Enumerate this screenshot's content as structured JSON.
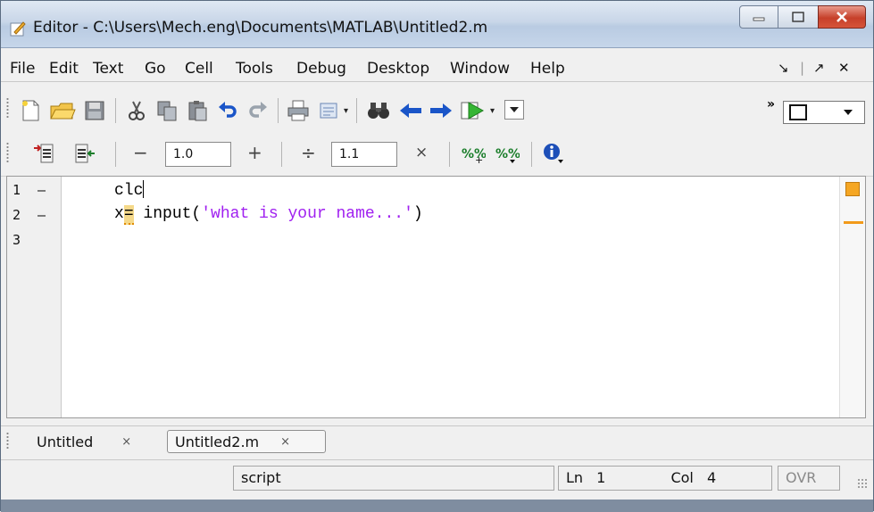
{
  "window": {
    "title": "Editor - C:\\Users\\Mech.eng\\Documents\\MATLAB\\Untitled2.m"
  },
  "menu": {
    "items": [
      "File",
      "Edit",
      "Text",
      "Go",
      "Cell",
      "Tools",
      "Debug",
      "Desktop",
      "Window",
      "Help"
    ],
    "undock_glyph": "↘",
    "maximize_glyph": "↗",
    "close_glyph": "✕"
  },
  "cell_toolbar": {
    "decrement_label": "−",
    "value1": "1.0",
    "increment_label": "+",
    "divide_label": "÷",
    "value2": "1.1",
    "multiply_label": "×"
  },
  "editor": {
    "lines": [
      {
        "number": "1",
        "marker": "—",
        "code": "clc"
      },
      {
        "number": "2",
        "marker": "—",
        "code_prefix": "x",
        "code_op": "=",
        "code_func": " input(",
        "code_string": "'what is your name...'",
        "code_suffix": ")"
      },
      {
        "number": "3",
        "marker": "",
        "code": ""
      }
    ]
  },
  "tabs": [
    {
      "label": "Untitled",
      "close": "×"
    },
    {
      "label": "Untitled2.m",
      "close": "×"
    }
  ],
  "status": {
    "mode": "script",
    "line_label": "Ln",
    "line_value": "1",
    "col_label": "Col",
    "col_value": "4",
    "ovr": "OVR"
  },
  "colors": {
    "string": "#a020f0",
    "warning": "#f5a623"
  }
}
